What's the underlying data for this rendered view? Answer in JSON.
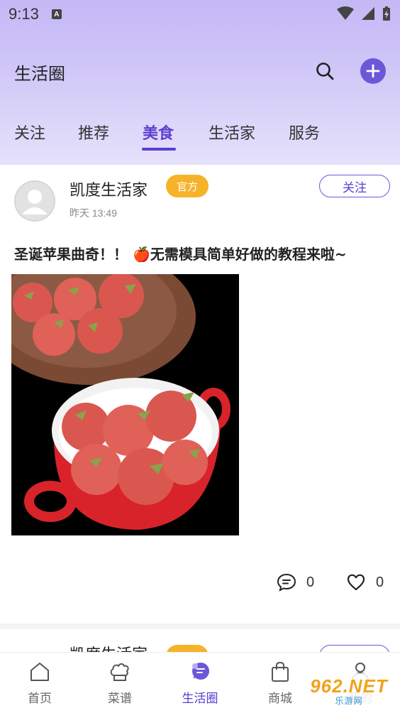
{
  "status_bar": {
    "time": "9:13",
    "notification_letter": "A"
  },
  "header": {
    "title": "生活圈"
  },
  "tabs": [
    {
      "label": "关注",
      "active": false
    },
    {
      "label": "推荐",
      "active": false
    },
    {
      "label": "美食",
      "active": true
    },
    {
      "label": "生活家",
      "active": false
    },
    {
      "label": "服务",
      "active": false
    }
  ],
  "post": {
    "author": "凯度生活家",
    "badge": "官方",
    "time": "昨天 13:49",
    "follow_label": "关注",
    "title": "圣诞苹果曲奇！！ 🍎无需模具简单好做的教程来啦~",
    "comment_count": "0",
    "like_count": "0"
  },
  "next_post": {
    "author": "凯度生活家"
  },
  "bottom_nav": [
    {
      "label": "首页",
      "icon": "home-icon",
      "active": false
    },
    {
      "label": "菜谱",
      "icon": "chef-hat-icon",
      "active": false
    },
    {
      "label": "生活圈",
      "icon": "chat-bubble-icon",
      "active": true
    },
    {
      "label": "商城",
      "icon": "shopping-bag-icon",
      "active": false
    },
    {
      "label": "我的",
      "icon": "user-icon",
      "active": false
    }
  ],
  "watermark": {
    "top": "962.NET",
    "bottom": "乐游网"
  },
  "colors": {
    "accent": "#5b3fd0",
    "badge": "#f6b32a",
    "header_gradient_top": "#c4b8f5"
  }
}
